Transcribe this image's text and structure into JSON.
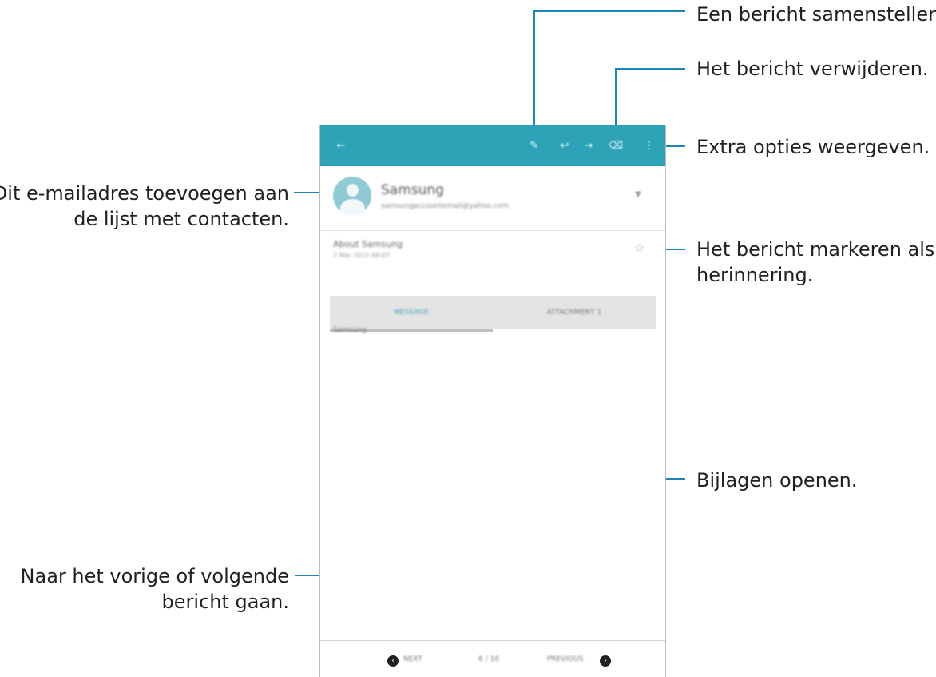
{
  "callouts": {
    "compose": "Een bericht samenstellen.",
    "delete": "Het bericht verwijderen.",
    "more": "Extra opties weergeven.",
    "add_contact_line1": "Dit e-mailadres toevoegen aan",
    "add_contact_line2": "de lijst met contacten.",
    "reminder_line1": "Het bericht markeren als",
    "reminder_line2": "herinnering.",
    "attachments": "Bijlagen openen.",
    "nav_line1": "Naar het vorige of volgende",
    "nav_line2": "bericht gaan."
  },
  "toolbar": {
    "background": "#2ea3b8",
    "icons": [
      "back-arrow-icon",
      "compose-icon",
      "reply-icon",
      "forward-icon",
      "delete-icon",
      "more-options-icon"
    ]
  },
  "message": {
    "sender_name": "Samsung",
    "sender_email": "samsungaccountemail@yahoo.com",
    "subject": "About Samsung",
    "date": "2 Mar 2015 08:07",
    "body": "Samsung"
  },
  "tabs": [
    "Message",
    "Attachment 1"
  ],
  "navigation": {
    "next_label": "Next",
    "counter": "6 / 10",
    "previous_label": "Previous"
  },
  "colors": {
    "callout_line": "#1a85b8",
    "text": "#231f20"
  }
}
